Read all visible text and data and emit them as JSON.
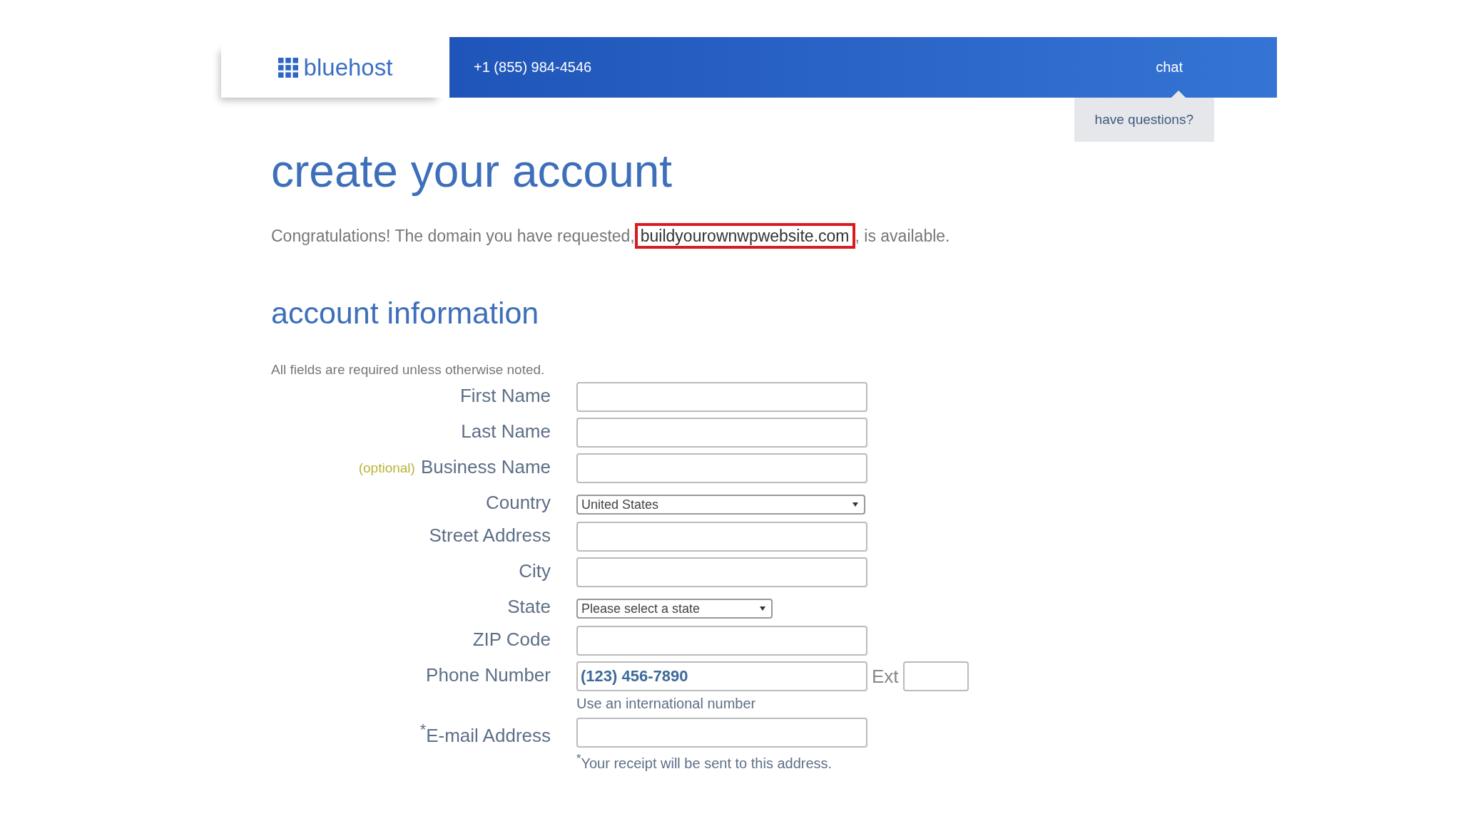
{
  "header": {
    "logo": "bluehost",
    "phone": "+1 (855) 984-4546",
    "chat": "chat",
    "chat_tooltip": "have questions?"
  },
  "title": "create your account",
  "congrats": {
    "before": "Congratulations! The domain you have requested,",
    "domain": "buildyourownwpwebsite.com",
    "after": ", is available.",
    "domain_highlighted": true
  },
  "section_title": "account information",
  "note": "All fields are required unless otherwise noted.",
  "fields": [
    {
      "kind": "text",
      "label": "First Name"
    },
    {
      "kind": "text",
      "label": "Last Name"
    },
    {
      "kind": "text",
      "label": "Business Name",
      "optional": "(optional)"
    },
    {
      "kind": "select",
      "label": "Country",
      "value": "United States"
    },
    {
      "kind": "text",
      "label": "Street Address"
    },
    {
      "kind": "text",
      "label": "City"
    },
    {
      "kind": "shortselect",
      "label": "State",
      "value": "Please select a state"
    },
    {
      "kind": "text",
      "label": "ZIP Code"
    },
    {
      "kind": "phone",
      "label": "Phone Number",
      "placeholder": "(123) 456-7890",
      "ext": "Ext",
      "help": "Use an international number"
    },
    {
      "kind": "text",
      "label": "$^{*}$E-mail Address",
      "help": "$^{*}$Your receipt will be sent to this address."
    }
  ]
}
